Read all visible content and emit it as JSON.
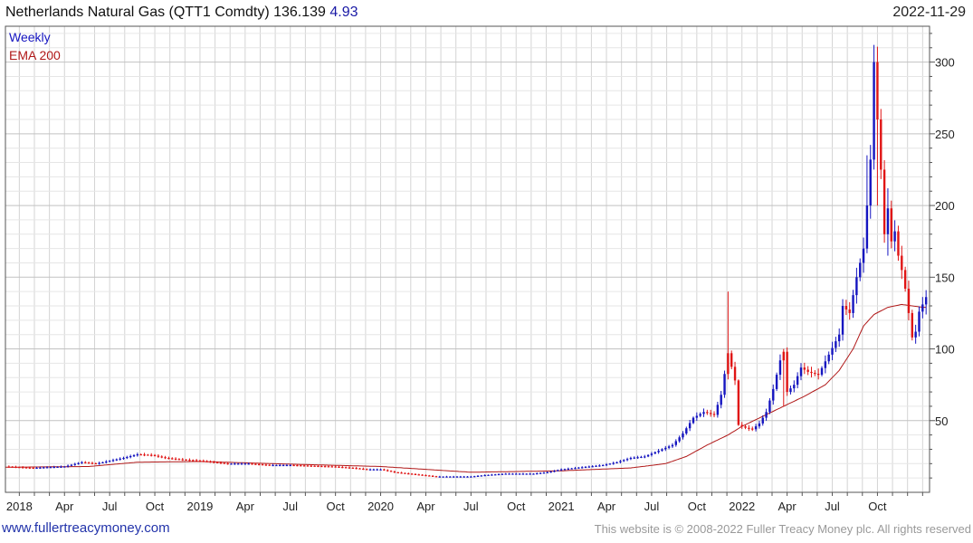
{
  "header": {
    "title": "Netherlands Natural Gas (QTT1 Comdty) 136.139",
    "change": "4.93",
    "date": "2022-11-29"
  },
  "footer": {
    "url": "www.fullertreacymoney.com",
    "copyright": "This website is © 2008-2022 Fuller Treacy Money plc. All rights reserved"
  },
  "colors": {
    "up": "#1515c0",
    "down": "#e01515",
    "ema": "#b01818",
    "grid": "#d4d4d4"
  },
  "chart_data": {
    "type": "candlestick",
    "legend": [
      {
        "name": "Weekly",
        "color": "#1515c0"
      },
      {
        "name": "EMA 200",
        "color": "#b01818"
      }
    ],
    "legend_position": "top-left",
    "grid": true,
    "y_axis_side": "right",
    "ylim": [
      0,
      325
    ],
    "yticks": [
      50,
      100,
      150,
      200,
      250,
      300
    ],
    "x_labels": [
      {
        "label": "2018",
        "t": 0
      },
      {
        "label": "Apr",
        "t": 13
      },
      {
        "label": "Jul",
        "t": 26
      },
      {
        "label": "Oct",
        "t": 39
      },
      {
        "label": "2019",
        "t": 52
      },
      {
        "label": "Apr",
        "t": 65
      },
      {
        "label": "Jul",
        "t": 78
      },
      {
        "label": "Oct",
        "t": 91
      },
      {
        "label": "2020",
        "t": 104
      },
      {
        "label": "Apr",
        "t": 117
      },
      {
        "label": "Jul",
        "t": 130
      },
      {
        "label": "Oct",
        "t": 143
      },
      {
        "label": "2021",
        "t": 156
      },
      {
        "label": "Apr",
        "t": 169
      },
      {
        "label": "Jul",
        "t": 182
      },
      {
        "label": "Oct",
        "t": 195
      },
      {
        "label": "2022",
        "t": 208
      },
      {
        "label": "Apr",
        "t": 221
      },
      {
        "label": "Jul",
        "t": 234
      },
      {
        "label": "Oct",
        "t": 247
      }
    ],
    "close_anchors": [
      [
        -4,
        18
      ],
      [
        4,
        17
      ],
      [
        8,
        17.5
      ],
      [
        13,
        18
      ],
      [
        18,
        21
      ],
      [
        22,
        20
      ],
      [
        26,
        22
      ],
      [
        30,
        24
      ],
      [
        34,
        26.5
      ],
      [
        38,
        26
      ],
      [
        42,
        24
      ],
      [
        46,
        23
      ],
      [
        52,
        22
      ],
      [
        56,
        21
      ],
      [
        60,
        20
      ],
      [
        66,
        20
      ],
      [
        72,
        19
      ],
      [
        78,
        19
      ],
      [
        84,
        18.5
      ],
      [
        90,
        18
      ],
      [
        96,
        17
      ],
      [
        100,
        16
      ],
      [
        104,
        16
      ],
      [
        108,
        14
      ],
      [
        112,
        13
      ],
      [
        116,
        12
      ],
      [
        120,
        11
      ],
      [
        126,
        11
      ],
      [
        130,
        11
      ],
      [
        134,
        12
      ],
      [
        140,
        13
      ],
      [
        144,
        13
      ],
      [
        148,
        13
      ],
      [
        152,
        14
      ],
      [
        156,
        16
      ],
      [
        160,
        17
      ],
      [
        164,
        18
      ],
      [
        168,
        19
      ],
      [
        172,
        21
      ],
      [
        176,
        24
      ],
      [
        180,
        25
      ],
      [
        184,
        29
      ],
      [
        188,
        33
      ],
      [
        191,
        41
      ],
      [
        194,
        52
      ],
      [
        197,
        56
      ],
      [
        200,
        54
      ],
      [
        202,
        68
      ],
      [
        204,
        97
      ],
      [
        206,
        78
      ],
      [
        207,
        47
      ],
      [
        209,
        45
      ],
      [
        211,
        44
      ],
      [
        213,
        48
      ],
      [
        215,
        56
      ],
      [
        217,
        72
      ],
      [
        219,
        92
      ],
      [
        220,
        98
      ],
      [
        221,
        70
      ],
      [
        223,
        75
      ],
      [
        225,
        87
      ],
      [
        227,
        84
      ],
      [
        230,
        82
      ],
      [
        233,
        96
      ],
      [
        236,
        110
      ],
      [
        237,
        130
      ],
      [
        239,
        125
      ],
      [
        241,
        150
      ],
      [
        243,
        170
      ],
      [
        244,
        200
      ],
      [
        245,
        232
      ],
      [
        246,
        300
      ],
      [
        247,
        260
      ],
      [
        248,
        225
      ],
      [
        249,
        180
      ],
      [
        250,
        198
      ],
      [
        251,
        175
      ],
      [
        252,
        182
      ],
      [
        253,
        165
      ],
      [
        254,
        155
      ],
      [
        255,
        142
      ],
      [
        256,
        125
      ],
      [
        257,
        108
      ],
      [
        258,
        112
      ],
      [
        259,
        126
      ],
      [
        260,
        131
      ],
      [
        261,
        136.139
      ]
    ],
    "events": [
      {
        "t": 204,
        "high": 140,
        "low": 80,
        "dir": "down"
      },
      {
        "t": 246,
        "high": 312,
        "low": 240,
        "dir": "up"
      },
      {
        "t": 247,
        "high": 308,
        "low": 200,
        "dir": "down"
      },
      {
        "t": 244,
        "high": 235,
        "low": 175,
        "dir": "up"
      },
      {
        "t": 250,
        "high": 212,
        "low": 165,
        "dir": "up"
      },
      {
        "t": 220,
        "high": 100,
        "low": 60,
        "dir": "down"
      },
      {
        "t": 261,
        "high": 141,
        "low": 124,
        "dir": "up"
      }
    ],
    "ema_anchors": [
      [
        -4,
        17.5
      ],
      [
        20,
        18
      ],
      [
        34,
        21
      ],
      [
        52,
        21.5
      ],
      [
        80,
        19.5
      ],
      [
        104,
        18
      ],
      [
        130,
        14
      ],
      [
        156,
        15
      ],
      [
        176,
        17
      ],
      [
        186,
        20
      ],
      [
        192,
        25
      ],
      [
        198,
        33
      ],
      [
        204,
        40
      ],
      [
        208,
        46
      ],
      [
        214,
        53
      ],
      [
        220,
        60
      ],
      [
        226,
        67
      ],
      [
        232,
        75
      ],
      [
        236,
        85
      ],
      [
        240,
        100
      ],
      [
        243,
        116
      ],
      [
        246,
        124
      ],
      [
        250,
        129
      ],
      [
        254,
        131
      ],
      [
        257,
        130
      ],
      [
        260,
        129
      ],
      [
        261,
        129
      ]
    ],
    "x_range": [
      -4,
      262
    ]
  }
}
